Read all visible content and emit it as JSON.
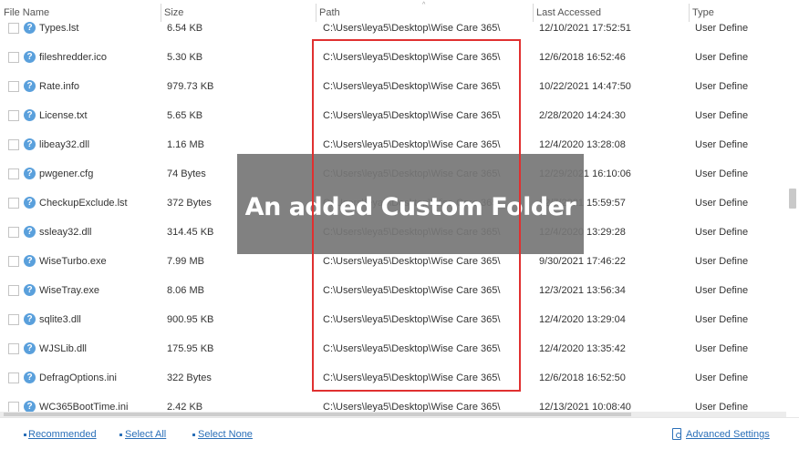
{
  "columns": [
    "File Name",
    "Size",
    "Path",
    "Last Accessed",
    "Type"
  ],
  "rows": [
    {
      "name": "Types.lst",
      "size": "6.54 KB",
      "path": "C:\\Users\\leya5\\Desktop\\Wise Care 365\\",
      "accessed": "12/10/2021 17:52:51",
      "type": "User Define"
    },
    {
      "name": "fileshredder.ico",
      "size": "5.30 KB",
      "path": "C:\\Users\\leya5\\Desktop\\Wise Care 365\\",
      "accessed": "12/6/2018 16:52:46",
      "type": "User Define"
    },
    {
      "name": "Rate.info",
      "size": "979.73 KB",
      "path": "C:\\Users\\leya5\\Desktop\\Wise Care 365\\",
      "accessed": "10/22/2021 14:47:50",
      "type": "User Define"
    },
    {
      "name": "License.txt",
      "size": "5.65 KB",
      "path": "C:\\Users\\leya5\\Desktop\\Wise Care 365\\",
      "accessed": "2/28/2020 14:24:30",
      "type": "User Define"
    },
    {
      "name": "libeay32.dll",
      "size": "1.16 MB",
      "path": "C:\\Users\\leya5\\Desktop\\Wise Care 365\\",
      "accessed": "12/4/2020 13:28:08",
      "type": "User Define"
    },
    {
      "name": "pwgener.cfg",
      "size": "74 Bytes",
      "path": "C:\\Users\\leya5\\Desktop\\Wise Care 365\\",
      "accessed": "12/29/2021 16:10:06",
      "type": "User Define"
    },
    {
      "name": "CheckupExclude.lst",
      "size": "372 Bytes",
      "path": "C:\\Users\\leya5\\Desktop\\Wise Care 365\\",
      "accessed": "12/7/2021 15:59:57",
      "type": "User Define"
    },
    {
      "name": "ssleay32.dll",
      "size": "314.45 KB",
      "path": "C:\\Users\\leya5\\Desktop\\Wise Care 365\\",
      "accessed": "12/4/2020 13:29:28",
      "type": "User Define"
    },
    {
      "name": "WiseTurbo.exe",
      "size": "7.99 MB",
      "path": "C:\\Users\\leya5\\Desktop\\Wise Care 365\\",
      "accessed": "9/30/2021 17:46:22",
      "type": "User Define"
    },
    {
      "name": "WiseTray.exe",
      "size": "8.06 MB",
      "path": "C:\\Users\\leya5\\Desktop\\Wise Care 365\\",
      "accessed": "12/3/2021 13:56:34",
      "type": "User Define"
    },
    {
      "name": "sqlite3.dll",
      "size": "900.95 KB",
      "path": "C:\\Users\\leya5\\Desktop\\Wise Care 365\\",
      "accessed": "12/4/2020 13:29:04",
      "type": "User Define"
    },
    {
      "name": "WJSLib.dll",
      "size": "175.95 KB",
      "path": "C:\\Users\\leya5\\Desktop\\Wise Care 365\\",
      "accessed": "12/4/2020 13:35:42",
      "type": "User Define"
    },
    {
      "name": "DefragOptions.ini",
      "size": "322 Bytes",
      "path": "C:\\Users\\leya5\\Desktop\\Wise Care 365\\",
      "accessed": "12/6/2018 16:52:50",
      "type": "User Define"
    },
    {
      "name": "WC365BootTime.ini",
      "size": "2.42 KB",
      "path": "C:\\Users\\leya5\\Desktop\\Wise Care 365\\",
      "accessed": "12/13/2021 10:08:40",
      "type": "User Define"
    }
  ],
  "overlay_caption": "An added Custom Folder",
  "footer": {
    "recommended": "Recommended",
    "select_all": "Select All",
    "select_none": "Select None",
    "advanced_settings": "Advanced Settings"
  },
  "icons": {
    "file": "question-mark-icon",
    "sort": "sort-ascending-icon",
    "settings": "advanced-settings-icon"
  },
  "colors": {
    "link": "#2a6fb8",
    "highlight_border": "#e03030",
    "file_icon": "#5aa0dc",
    "overlay": "#767676"
  }
}
